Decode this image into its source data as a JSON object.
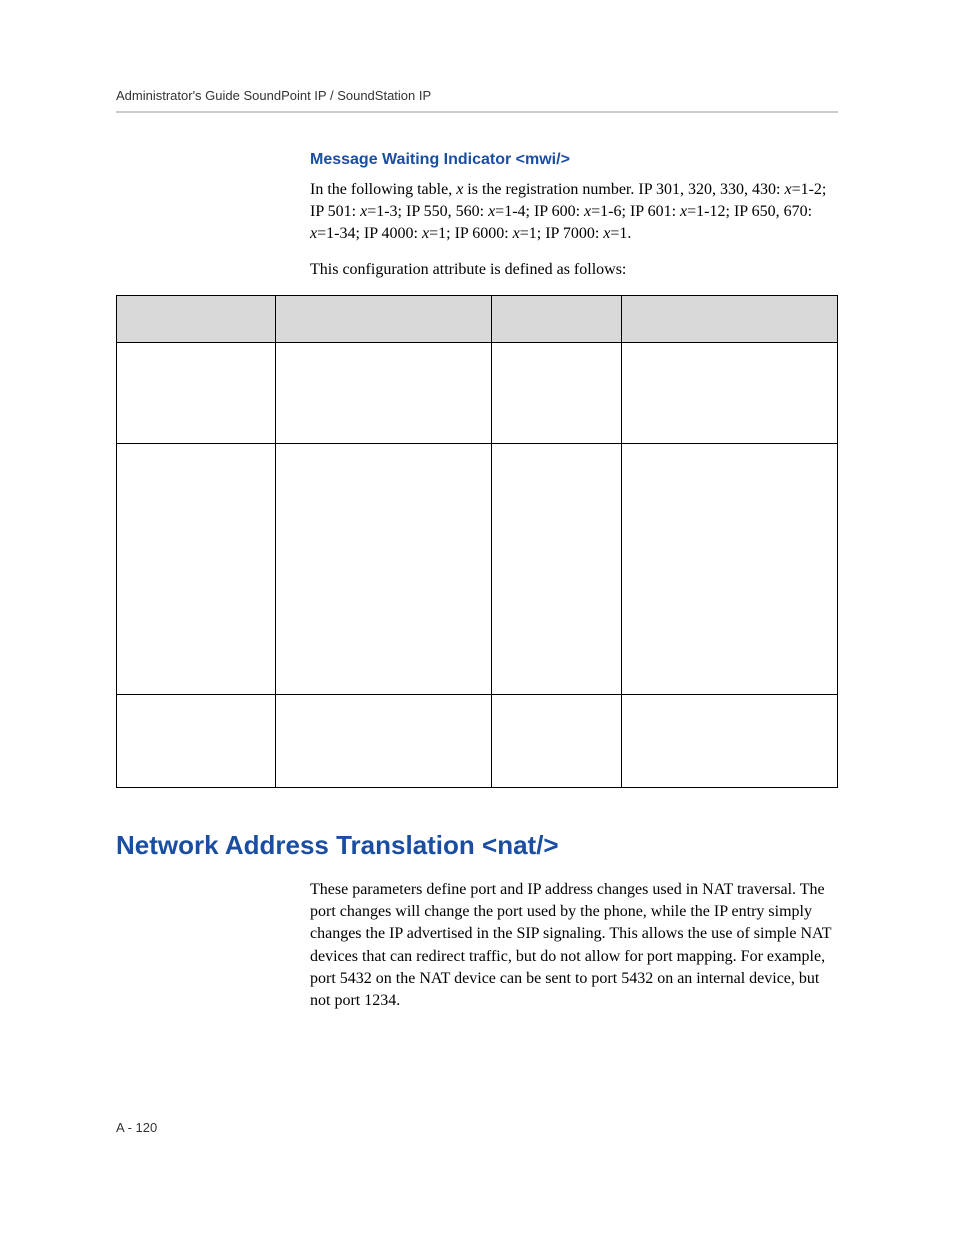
{
  "running_head": "Administrator's Guide SoundPoint IP / SoundStation IP",
  "subsection_title": "Message Waiting Indicator <mwi/>",
  "intro_part1": "In the following table, ",
  "intro_x": "x",
  "intro_part2": " is the registration number. IP 301, 320, 330, 430: ",
  "intro_part3": "=1-2; IP 501: ",
  "intro_part4": "=1-3; IP 550, 560: ",
  "intro_part5": "=1-4; IP 600: ",
  "intro_part6": "=1-6; IP 601: ",
  "intro_part7": "=1-12; IP 650, 670: ",
  "intro_part8": "=1-34; IP 4000: ",
  "intro_part9": "=1; IP 6000: ",
  "intro_part10": "=1; IP 7000: ",
  "intro_part11": "=1.",
  "intro2": "This configuration attribute is defined as follows:",
  "table": {
    "headers": [
      "",
      "",
      "",
      ""
    ],
    "rows": [
      [
        "",
        "",
        "",
        ""
      ],
      [
        "",
        "",
        "",
        ""
      ],
      [
        "",
        "",
        "",
        ""
      ]
    ]
  },
  "section_title": "Network Address Translation <nat/>",
  "section_body": "These parameters define port and IP address changes used in NAT traversal. The port changes will change the port used by the phone, while the IP entry simply changes the IP advertised in the SIP signaling. This allows the use of simple NAT devices that can redirect traffic, but do not allow for port mapping. For example, port 5432 on the NAT device can be sent to port 5432 on an internal device, but not port 1234.",
  "page_num": "A - 120"
}
